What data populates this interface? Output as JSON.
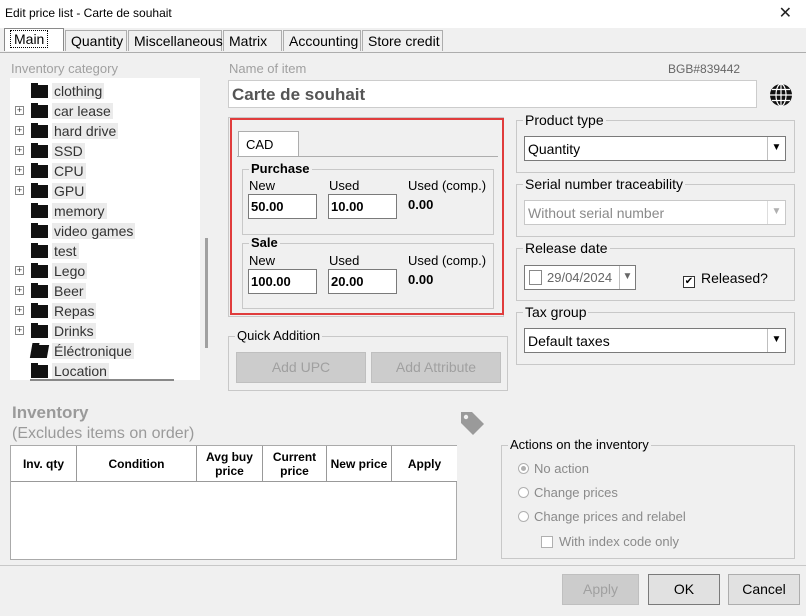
{
  "window": {
    "title": "Edit price list - Carte de souhait",
    "close": "✕"
  },
  "tabs": [
    "Main",
    "Quantity",
    "Miscellaneous",
    "Matrix",
    "Accounting",
    "Store credit"
  ],
  "category": {
    "label": "Inventory category",
    "items": [
      {
        "label": "clothing",
        "expandable": false
      },
      {
        "label": "car lease",
        "expandable": true
      },
      {
        "label": "hard drive",
        "expandable": true
      },
      {
        "label": "SSD",
        "expandable": true
      },
      {
        "label": "CPU",
        "expandable": true
      },
      {
        "label": "GPU",
        "expandable": true
      },
      {
        "label": "memory",
        "expandable": false
      },
      {
        "label": "video games",
        "expandable": false
      },
      {
        "label": "test",
        "expandable": false
      },
      {
        "label": "Lego",
        "expandable": true
      },
      {
        "label": "Beer",
        "expandable": true
      },
      {
        "label": "Repas",
        "expandable": true
      },
      {
        "label": "Drinks",
        "expandable": true
      },
      {
        "label": "Éléctronique",
        "expandable": false
      },
      {
        "label": "Location",
        "expandable": false
      }
    ]
  },
  "item": {
    "name_label": "Name of item",
    "code": "BGB#839442",
    "name": "Carte de souhait"
  },
  "prices": {
    "currency_tab": "CAD",
    "purchase": {
      "label": "Purchase",
      "new_label": "New",
      "used_label": "Used",
      "used_comp_label": "Used (comp.)",
      "new": "50.00",
      "used": "10.00",
      "used_comp": "0.00"
    },
    "sale": {
      "label": "Sale",
      "new_label": "New",
      "used_label": "Used",
      "used_comp_label": "Used (comp.)",
      "new": "100.00",
      "used": "20.00",
      "used_comp": "0.00"
    },
    "highlight_color": "#e03c3c"
  },
  "quick_addition": {
    "label": "Quick Addition",
    "add_upc": "Add UPC",
    "add_attribute": "Add Attribute"
  },
  "product_type": {
    "label": "Product type",
    "value": "Quantity"
  },
  "serial": {
    "label": "Serial number traceability",
    "value": "Without serial number"
  },
  "release": {
    "label": "Release date",
    "date": "29/04/2024",
    "released_label": "Released?",
    "released": true
  },
  "tax": {
    "label": "Tax group",
    "value": "Default taxes"
  },
  "inventory": {
    "title": "Inventory",
    "subtitle": "(Excludes items on order)",
    "columns": [
      "Inv. qty",
      "Condition",
      "Avg buy price",
      "Current price",
      "New price",
      "Apply"
    ]
  },
  "actions": {
    "label": "Actions on the inventory",
    "options": [
      "No action",
      "Change prices",
      "Change prices and relabel"
    ],
    "selected": 0,
    "index_code": "With index code only"
  },
  "footer": {
    "apply": "Apply",
    "ok": "OK",
    "cancel": "Cancel"
  }
}
